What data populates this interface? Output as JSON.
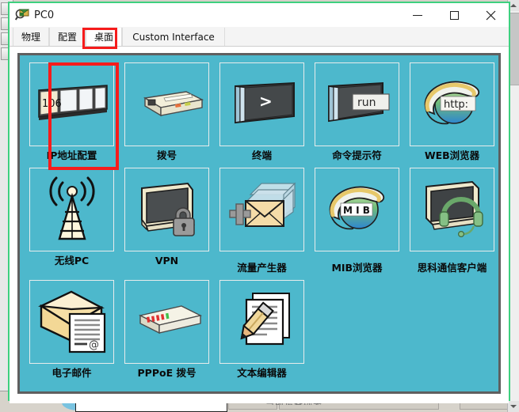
{
  "window": {
    "title": "PC0",
    "icon": "packet-tracer-device-icon",
    "controls": {
      "minimize": "—",
      "maximize": "□",
      "close": "✕"
    }
  },
  "tabs": [
    {
      "label": "物理",
      "selected": false
    },
    {
      "label": "配置",
      "selected": false
    },
    {
      "label": "桌面",
      "selected": true,
      "highlighted": true
    },
    {
      "label": "Custom Interface",
      "selected": false
    }
  ],
  "desktop": {
    "background_color": "#4db8cc",
    "highlight_color": "#f61c1c",
    "items": [
      {
        "label": "IP地址配置",
        "icon": "ip-configuration-icon",
        "highlighted": true,
        "badge": "106"
      },
      {
        "label": "拨号",
        "icon": "dial-up-modem-icon",
        "highlighted": false
      },
      {
        "label": "终端",
        "icon": "terminal-icon",
        "highlighted": false
      },
      {
        "label": "命令提示符",
        "icon": "command-prompt-icon",
        "highlighted": false,
        "badge": "run"
      },
      {
        "label": "WEB浏览器",
        "icon": "web-browser-icon",
        "highlighted": false,
        "badge": "http:"
      },
      {
        "label": "无线PC",
        "icon": "wireless-tower-icon",
        "highlighted": false
      },
      {
        "label": "VPN",
        "icon": "vpn-lock-icon",
        "highlighted": false
      },
      {
        "label": "流量产生器",
        "icon": "traffic-generator-icon",
        "highlighted": false
      },
      {
        "label": "MIB浏览器",
        "icon": "mib-browser-icon",
        "highlighted": false,
        "badge": "M I B"
      },
      {
        "label": "思科通信客户端",
        "icon": "cisco-ip-communicator-icon",
        "highlighted": false
      },
      {
        "label": "电子邮件",
        "icon": "email-icon",
        "highlighted": false
      },
      {
        "label": "PPPoE 拨号",
        "icon": "pppoe-dialer-icon",
        "highlighted": false
      },
      {
        "label": "文本编辑器",
        "icon": "text-editor-icon",
        "highlighted": false
      }
    ]
  },
  "background_app": {
    "status_text": "当前设备列表"
  }
}
